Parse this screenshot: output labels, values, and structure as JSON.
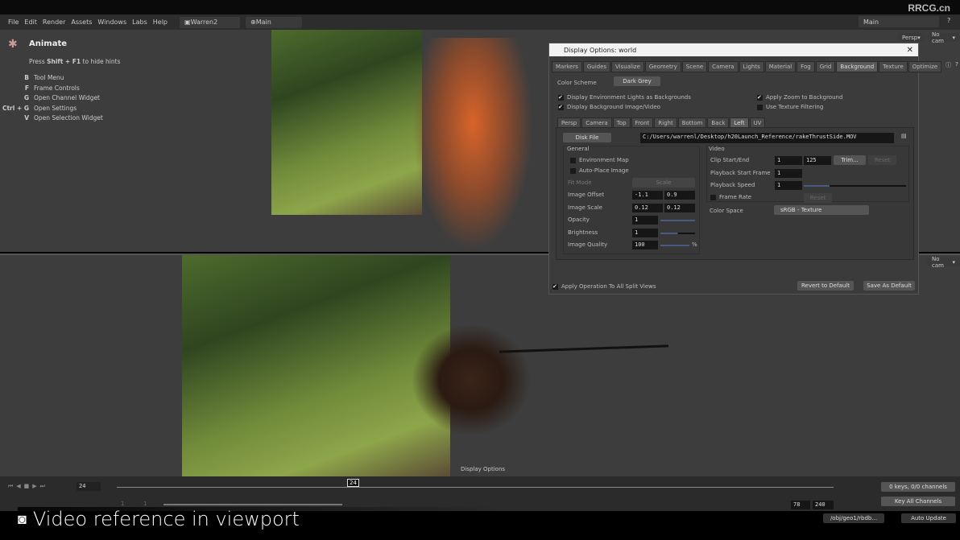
{
  "watermark": "RRCG.cn",
  "menu": [
    "File",
    "Edit",
    "Render",
    "Assets",
    "Windows",
    "Labs",
    "Help"
  ],
  "desktop": "Warren2",
  "context": "Main",
  "right_context": "Main",
  "hints": {
    "title": "Animate",
    "sub_pre": "Press ",
    "sub_key": "Shift + F1",
    "sub_post": " to hide hints",
    "items": [
      {
        "key": "B",
        "label": "Tool Menu"
      },
      {
        "key": "F",
        "label": "Frame Controls"
      },
      {
        "key": "G",
        "label": "Open Channel Widget"
      },
      {
        "key": "Ctrl + G",
        "label": "Open Settings"
      },
      {
        "key": "V",
        "label": "Open Selection Widget"
      }
    ]
  },
  "viewport": {
    "persp": "Persp",
    "nocam": "No cam",
    "status": "Display Options"
  },
  "dialog": {
    "title": "Display Options:  world",
    "tabs": [
      "Markers",
      "Guides",
      "Visualize",
      "Geometry",
      "Scene",
      "Camera",
      "Lights",
      "Material",
      "Fog",
      "Grid",
      "Background",
      "Texture",
      "Optimize"
    ],
    "color_scheme_label": "Color Scheme",
    "color_scheme": "Dark Grey",
    "checks": [
      "Display Environment Lights as Backgrounds",
      "Display Background Image/Video",
      "Apply Zoom to Background",
      "Use Texture Filtering"
    ],
    "view_tabs": [
      "Persp",
      "Camera",
      "Top",
      "Front",
      "Right",
      "Bottom",
      "Back",
      "Left",
      "UV"
    ],
    "source": "Disk File",
    "path": "C:/Users/warrenl/Desktop/h20Launch_Reference/rakeThrustSide.MOV",
    "general": {
      "title": "General",
      "env_map": "Environment Map",
      "auto_place": "Auto-Place Image",
      "fit_mode": "Fit Mode",
      "fit_value": "Scale",
      "offset_label": "Image Offset",
      "offset": [
        "-1.1",
        "0.9"
      ],
      "scale_label": "Image Scale",
      "scale": [
        "0.12",
        "0.12"
      ],
      "opacity_label": "Opacity",
      "opacity": "1",
      "brightness_label": "Brightness",
      "brightness": "1",
      "quality_label": "Image Quality",
      "quality": "100",
      "pct": "%"
    },
    "video": {
      "title": "Video",
      "clip_label": "Clip Start/End",
      "clip": [
        "1",
        "125"
      ],
      "trim": "Trim...",
      "reset": "Reset",
      "pstart_label": "Playback Start Frame",
      "pstart": "1",
      "speed_label": "Playback Speed",
      "speed": "1",
      "framerate_label": "Frame Rate",
      "colorspace_label": "Color Space",
      "colorspace": "sRGB - Texture"
    },
    "apply_all": "Apply Operation To All Split Views",
    "revert": "Revert to Default",
    "save": "Save As Default"
  },
  "timeline": {
    "frame": "24",
    "current": "24",
    "start": "1",
    "start2": "1",
    "end1": "78",
    "end2": "240",
    "keys": "0 keys, 0/0 channels",
    "key_all": "Key All Channels",
    "path": "/obj/geo1/rbdb...",
    "update": "Auto Update"
  },
  "caption": "Video reference in viewport"
}
